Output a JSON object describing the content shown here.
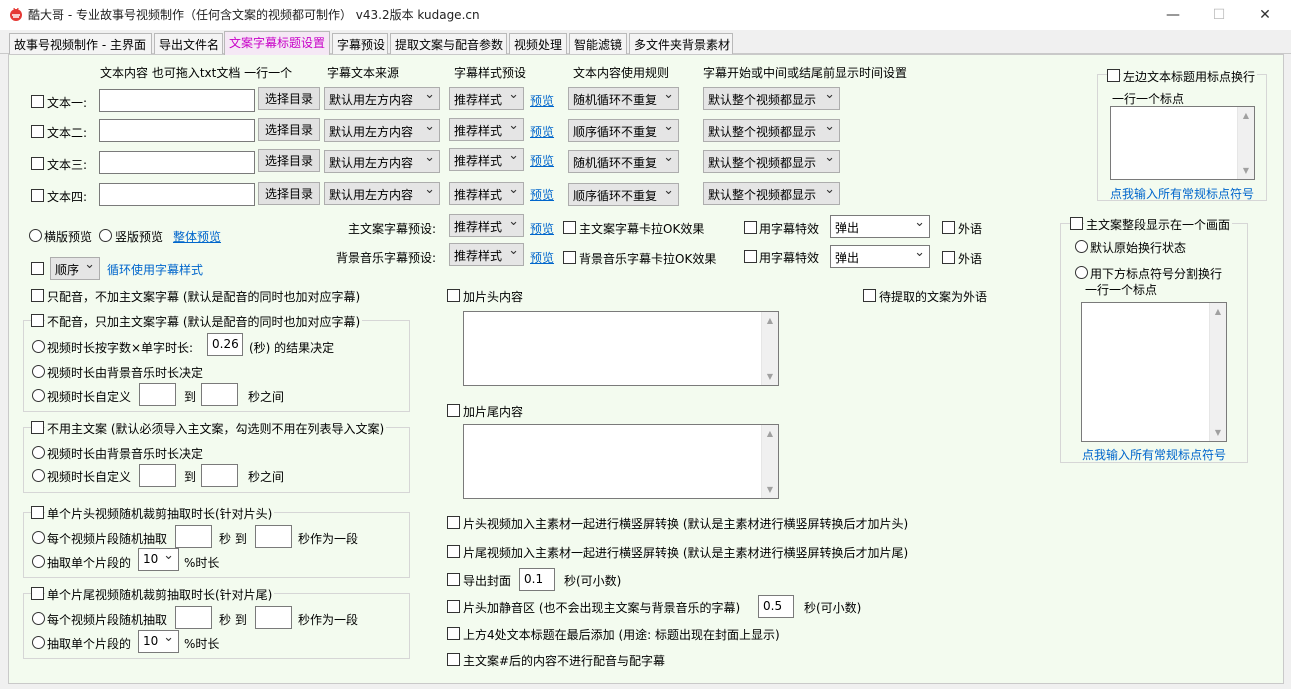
{
  "window": {
    "title": "酷大哥 -   专业故事号视频制作（任何含文案的视频都可制作）    v43.2版本    kudage.cn",
    "min_label": "—",
    "max_label": "☐",
    "close_label": "✕"
  },
  "tabs": [
    "故事号视频制作 - 主界面",
    "导出文件名",
    "文案字幕标题设置",
    "字幕预设",
    "提取文案与配音参数",
    "视频处理",
    "智能滤镜",
    "多文件夹背景素材"
  ],
  "headers": {
    "text_content": "文本内容 也可拖入txt文档 一行一个",
    "subtitle_source": "字幕文本来源",
    "style_preset": "字幕样式预设",
    "usage_rule": "文本内容使用规则",
    "display_time": "字幕开始或中间或结尾前显示时间设置"
  },
  "text_rows": [
    {
      "label": "文本一:",
      "value": "",
      "browse": "选择目录",
      "source": "默认用左方内容",
      "style": "推荐样式",
      "preview": "预览",
      "rule": "随机循环不重复",
      "display": "默认整个视频都显示"
    },
    {
      "label": "文本二:",
      "value": "",
      "browse": "选择目录",
      "source": "默认用左方内容",
      "style": "推荐样式",
      "preview": "预览",
      "rule": "顺序循环不重复",
      "display": "默认整个视频都显示"
    },
    {
      "label": "文本三:",
      "value": "",
      "browse": "选择目录",
      "source": "默认用左方内容",
      "style": "推荐样式",
      "preview": "预览",
      "rule": "随机循环不重复",
      "display": "默认整个视频都显示"
    },
    {
      "label": "文本四:",
      "value": "",
      "browse": "选择目录",
      "source": "默认用左方内容",
      "style": "推荐样式",
      "preview": "预览",
      "rule": "顺序循环不重复",
      "display": "默认整个视频都显示"
    }
  ],
  "preview_mode": {
    "horizontal": "横版预览",
    "vertical": "竖版预览",
    "overall": "整体预览"
  },
  "cycle": {
    "order": "顺序",
    "link": "循环使用字幕样式"
  },
  "main_preset": {
    "label": "主文案字幕预设:",
    "style": "推荐样式",
    "preview": "预览",
    "karaoke": "主文案字幕卡拉OK效果",
    "effect_cb": "用字幕特效",
    "effect": "弹出",
    "foreign": "外语"
  },
  "music_preset": {
    "label": "背景音乐字幕预设:",
    "style": "推荐样式",
    "preview": "预览",
    "karaoke": "背景音乐字幕卡拉OK效果",
    "effect_cb": "用字幕特效",
    "effect": "弹出",
    "foreign": "外语"
  },
  "left": {
    "only_dub": "只配音，不加主文案字幕 (默认是配音的同时也加对应字幕)",
    "no_dub_group": {
      "title": "不配音，只加主文案字幕 (默认是配音的同时也加对应字幕)",
      "opt1_prefix": "视频时长按字数×单字时长:",
      "opt1_value": "0.26",
      "opt1_suffix": "(秒) 的结果决定",
      "opt2": "视频时长由背景音乐时长决定",
      "opt3": "视频时长自定义",
      "to": "到",
      "between": "秒之间"
    },
    "no_main_group": {
      "title": "不用主文案 (默认必须导入主文案，勾选则不用在列表导入文案)",
      "opt1": "视频时长由背景音乐时长决定",
      "opt2": "视频时长自定义",
      "to": "到",
      "between": "秒之间"
    },
    "head_group": {
      "title": "单个片头视频随机裁剪抽取时长(针对片头)",
      "opt1": "每个视频片段随机抽取",
      "sec_to": "秒 到",
      "per_seg": "秒作为一段",
      "opt2": "抽取单个片段的",
      "pct": "10",
      "pct_suffix": "%时长"
    },
    "tail_group": {
      "title": "单个片尾视频随机裁剪抽取时长(针对片尾)",
      "opt1": "每个视频片段随机抽取",
      "sec_to": "秒 到",
      "per_seg": "秒作为一段",
      "opt2": "抽取单个片段的",
      "pct": "10",
      "pct_suffix": "%时长"
    }
  },
  "middle": {
    "add_head": "加片头内容",
    "foreign_pending": "待提取的文案为外语",
    "add_tail": "加片尾内容",
    "head_convert": "片头视频加入主素材一起进行横竖屏转换 (默认是主素材进行横竖屏转换后才加片头)",
    "tail_convert": "片尾视频加入主素材一起进行横竖屏转换 (默认是主素材进行横竖屏转换后才加片尾)",
    "cover_label": "导出封面",
    "cover_value": "0.1",
    "cover_suffix": "秒(可小数)",
    "silence_label": "片头加静音区 (也不会出现主文案与背景音乐的字幕)",
    "silence_value": "0.5",
    "silence_suffix": "秒(可小数)",
    "title_last": "上方4处文本标题在最后添加 (用途: 标题出现在封面上显示)",
    "hash_skip": "主文案#后的内容不进行配音与配字幕"
  },
  "right": {
    "top_group_title": "左边文本标题用标点换行",
    "top_hint": "一行一个标点",
    "top_link": "点我输入所有常规标点符号",
    "bottom_group_title": "主文案整段显示在一个画面",
    "opt_default": "默认原始换行状态",
    "opt_split": "用下方标点符号分割换行",
    "bottom_hint": "一行一个标点",
    "bottom_link": "点我输入所有常规标点符号"
  },
  "colors": {
    "panel_bg": "#f3fbef",
    "active_tab_text": "#c800c8",
    "link": "#0066cc"
  }
}
